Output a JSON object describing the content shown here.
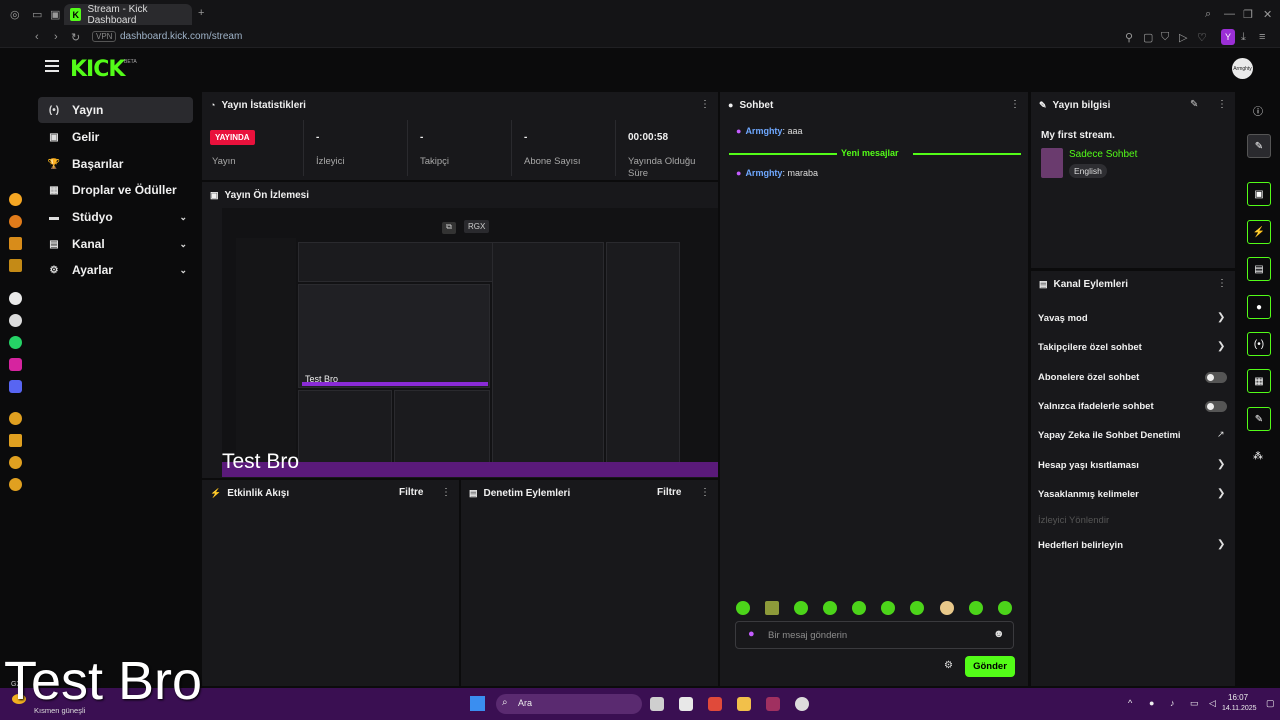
{
  "browser": {
    "tab_title": "Stream - Kick Dashboard",
    "tab_favicon": "K",
    "new_tab": "+",
    "vpn": "VPN",
    "url": "dashboard.kick.com/stream",
    "profile_initial": "Y"
  },
  "header": {
    "logo": "KICK",
    "beta": "BETA",
    "avatar_text": "Armghty"
  },
  "nav": {
    "items": [
      {
        "label": "Yayın",
        "icon": "(•)"
      },
      {
        "label": "Gelir",
        "icon": "▣"
      },
      {
        "label": "Başarılar",
        "icon": "🏆"
      },
      {
        "label": "Droplar ve Ödüller",
        "icon": "▦"
      },
      {
        "label": "Stüdyo",
        "icon": "▬"
      },
      {
        "label": "Kanal",
        "icon": "▤"
      },
      {
        "label": "Ayarlar",
        "icon": "⚙"
      }
    ]
  },
  "stats": {
    "title": "Yayın İstatistikleri",
    "live_badge": "YAYINDA",
    "cols": [
      {
        "value": "",
        "label": "Yayın"
      },
      {
        "value": "-",
        "label": "İzleyici"
      },
      {
        "value": "-",
        "label": "Takipçi"
      },
      {
        "value": "-",
        "label": "Abone Sayısı"
      },
      {
        "value": "00:00:58",
        "label": "Yayında Olduğu Süre"
      }
    ]
  },
  "preview": {
    "title": "Yayın Ön İzlemesi",
    "overlay_text": "Test Bro",
    "inner_text": "Test Bro",
    "badge": "RGX"
  },
  "activity": {
    "title": "Etkinlik Akışı",
    "filter": "Filtre"
  },
  "moderation": {
    "title": "Denetim Eylemleri",
    "filter": "Filtre"
  },
  "chat": {
    "title": "Sohbet",
    "messages": [
      {
        "user": "Armghty",
        "text": ": aaa"
      },
      {
        "user": "Armghty",
        "text": ": maraba"
      }
    ],
    "new_messages": "Yeni mesajlar",
    "placeholder": "Bir mesaj gönderin",
    "send": "Gönder"
  },
  "stream_info": {
    "title": "Yayın bilgisi",
    "stream_title": "My first stream.",
    "category": "Sadece Sohbet",
    "language": "English"
  },
  "channel_actions": {
    "title": "Kanal Eylemleri",
    "items": [
      {
        "label": "Yavaş mod",
        "control": "arrow"
      },
      {
        "label": "Takipçilere özel sohbet",
        "control": "arrow"
      },
      {
        "label": "Abonelere özel sohbet",
        "control": "toggle"
      },
      {
        "label": "Yalnızca ifadelerle sohbet",
        "control": "toggle"
      },
      {
        "label": "Yapay Zeka ile Sohbet Denetimi",
        "control": "external"
      },
      {
        "label": "Hesap yaşı kısıtlaması",
        "control": "arrow"
      },
      {
        "label": "Yasaklanmış kelimeler",
        "control": "arrow"
      },
      {
        "label": "İzleyici Yönlendir",
        "control": "disabled"
      },
      {
        "label": "Hedefleri belirleyin",
        "control": "arrow"
      }
    ]
  },
  "overlay_caption": "Test Bro",
  "taskbar": {
    "search": "Ara",
    "weather_temp": "GX",
    "weather_text": "Kısmen güneşli",
    "time": "16:07",
    "date": "14.11.2025"
  },
  "colors": {
    "accent": "#53fc18",
    "live": "#e9113c",
    "username": "#6fa8ff",
    "taskbar": "#3a0f52"
  }
}
